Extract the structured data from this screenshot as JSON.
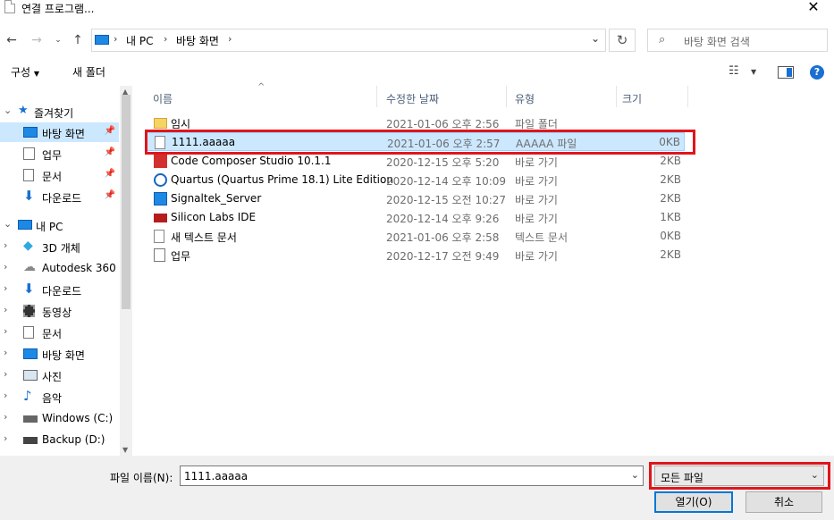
{
  "window": {
    "title": "연결 프로그램..."
  },
  "nav": {
    "breadcrumb": [
      "내 PC",
      "바탕 화면"
    ],
    "search_placeholder": "바탕 화면 검색"
  },
  "toolbar": {
    "organize_label": "구성",
    "new_folder_label": "새 폴더"
  },
  "sidebar": {
    "items": [
      {
        "label": "즐겨찾기",
        "icon": "star-icon",
        "pinned": false
      },
      {
        "label": "바탕 화면",
        "icon": "desktop-icon",
        "pinned": true
      },
      {
        "label": "업무",
        "icon": "shortcut-icon",
        "pinned": true
      },
      {
        "label": "문서",
        "icon": "document-icon",
        "pinned": true
      },
      {
        "label": "다운로드",
        "icon": "download-icon",
        "pinned": true
      },
      {
        "label": "내 PC",
        "icon": "pc-icon",
        "pinned": false
      },
      {
        "label": "3D 개체",
        "icon": "cube-icon",
        "pinned": false
      },
      {
        "label": "Autodesk 360",
        "icon": "cloud-icon",
        "pinned": false
      },
      {
        "label": "다운로드",
        "icon": "download-icon",
        "pinned": false
      },
      {
        "label": "동영상",
        "icon": "film-icon",
        "pinned": false
      },
      {
        "label": "문서",
        "icon": "document-icon",
        "pinned": false
      },
      {
        "label": "바탕 화면",
        "icon": "desktop-icon",
        "pinned": false
      },
      {
        "label": "사진",
        "icon": "picture-icon",
        "pinned": false
      },
      {
        "label": "음악",
        "icon": "music-icon",
        "pinned": false
      },
      {
        "label": "Windows (C:)",
        "icon": "drive-icon",
        "pinned": false
      },
      {
        "label": "Backup (D:)",
        "icon": "drive-icon",
        "pinned": false
      }
    ]
  },
  "columns": {
    "name": "이름",
    "date": "수정한 날짜",
    "type": "유형",
    "size": "크기"
  },
  "files": [
    {
      "name": "임시",
      "date": "2021-01-06 오후 2:56",
      "type": "파일 폴더",
      "size": "",
      "icon": "folder-icon"
    },
    {
      "name": "1111.aaaaa",
      "date": "2021-01-06 오후 2:57",
      "type": "AAAAA 파일",
      "size": "0KB",
      "icon": "file-icon"
    },
    {
      "name": "Code Composer Studio 10.1.1",
      "date": "2020-12-15 오후 5:20",
      "type": "바로 가기",
      "size": "2KB",
      "icon": "ccs-icon"
    },
    {
      "name": "Quartus (Quartus Prime 18.1) Lite Edition",
      "date": "2020-12-14 오후 10:09",
      "type": "바로 가기",
      "size": "2KB",
      "icon": "quartus-icon"
    },
    {
      "name": "Signaltek_Server",
      "date": "2020-12-15 오전 10:27",
      "type": "바로 가기",
      "size": "2KB",
      "icon": "app-window-icon"
    },
    {
      "name": "Silicon Labs IDE",
      "date": "2020-12-14 오후 9:26",
      "type": "바로 가기",
      "size": "1KB",
      "icon": "silabs-icon"
    },
    {
      "name": "새 텍스트 문서",
      "date": "2021-01-06 오후 2:58",
      "type": "텍스트 문서",
      "size": "0KB",
      "icon": "text-file-icon"
    },
    {
      "name": "업무",
      "date": "2020-12-17 오전 9:49",
      "type": "바로 가기",
      "size": "2KB",
      "icon": "shortcut-icon"
    }
  ],
  "bottom": {
    "filename_label": "파일 이름(N):",
    "filename_value": "1111.aaaaa",
    "filetype_value": "모든 파일",
    "open_label": "열기(O)",
    "cancel_label": "취소"
  },
  "colors": {
    "selection": "#cce8ff",
    "highlight": "#e0151b",
    "accent": "#0078d7"
  }
}
